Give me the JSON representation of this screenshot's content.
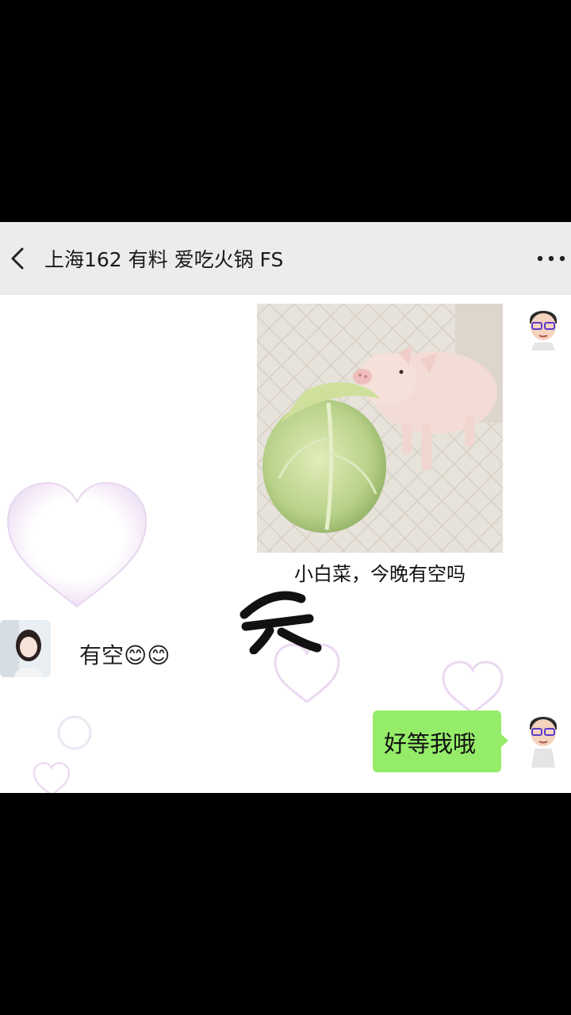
{
  "header": {
    "title": "上海162 有料 爱吃火锅 FS",
    "back_icon": "chevron-left-icon",
    "more_icon": "more-horizontal-icon",
    "background": "#ececec"
  },
  "messages": [
    {
      "direction": "sent",
      "type": "image",
      "caption": "小白菜，今晚有空吗",
      "image_subject": "piglet-eating-cabbage"
    },
    {
      "direction": "received",
      "type": "text",
      "text": "有空😊😊"
    },
    {
      "direction": "sent",
      "type": "text",
      "text": "好等我哦"
    }
  ],
  "colors": {
    "sent_bubble": "#95ec69",
    "chat_background": "#ffffff",
    "letterbox": "#000000"
  }
}
